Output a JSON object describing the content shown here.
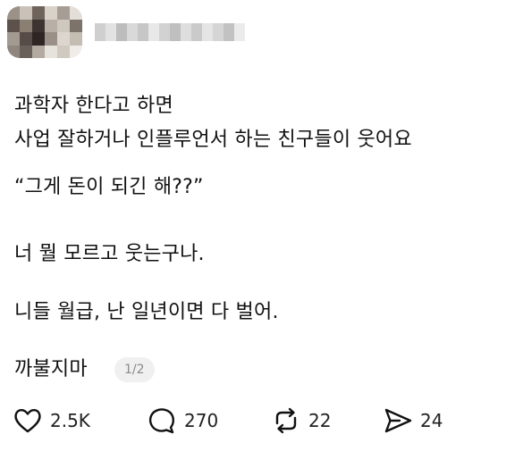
{
  "post": {
    "author": {
      "username": "beryadinges sit",
      "avatar_colors": [
        "#9a9187",
        "#c9c2b8",
        "#6e645c",
        "#d8d2c9",
        "#a69e94",
        "#e3dfd8",
        "#5c524b",
        "#8b7f74",
        "#3d3431",
        "#b8b0a6",
        "#cfc8bf",
        "#7c736a",
        "#a39b92",
        "#574c47",
        "#2e2624",
        "#9a9088",
        "#dcd6ce",
        "#c4bdb3",
        "#8f867e",
        "#6a605a",
        "#b3aaa1",
        "#e6e2dc",
        "#d0c9c0",
        "#f0ede9"
      ],
      "username_colors": [
        "#cfcfcf",
        "#e2e2e2",
        "#bdbdbd",
        "#d9d9d9",
        "#c6c6c6",
        "#e8e8e8",
        "#d2d2d2",
        "#bfbfbf",
        "#dedede",
        "#cacaca",
        "#e5e5e5",
        "#d5d5d5",
        "#c2c2c2",
        "#ebebeb"
      ]
    },
    "lines": [
      "과학자 한다고 하면",
      "사업 잘하거나 인플루언서 하는 친구들이 웃어요",
      "“그게 돈이 되긴 해??”",
      "너 뭘 모르고 웃는구나.",
      "니들 월급, 난 일년이면 다 벌어.",
      "까불지마"
    ],
    "pager": "1/2",
    "actions": {
      "likes": "2.5K",
      "replies": "270",
      "reposts": "22",
      "shares": "24"
    }
  }
}
